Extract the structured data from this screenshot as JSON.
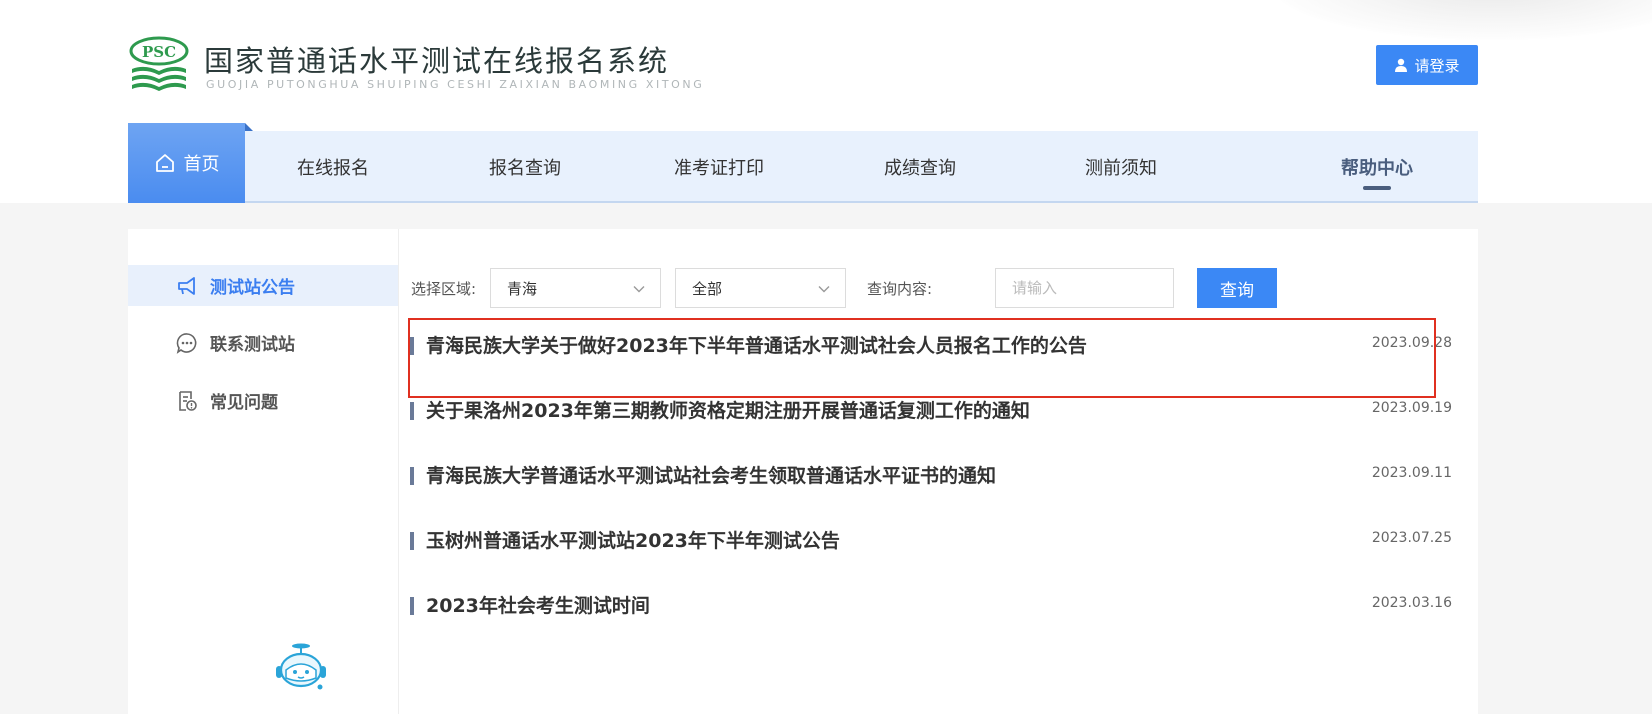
{
  "header": {
    "logo_text": "PSC",
    "title": "国家普通话水平测试在线报名系统",
    "subtitle": "GUOJIA PUTONGHUA SHUIPING CESHI ZAIXIAN BAOMING XITONG",
    "login_label": "请登录"
  },
  "nav": {
    "items": [
      {
        "label": "首页",
        "icon": "home-icon"
      },
      {
        "label": "在线报名"
      },
      {
        "label": "报名查询"
      },
      {
        "label": "准考证打印"
      },
      {
        "label": "成绩查询"
      },
      {
        "label": "测前须知"
      },
      {
        "label": "帮助中心"
      }
    ],
    "active_index": 6
  },
  "sidebar": {
    "items": [
      {
        "label": "测试站公告",
        "icon": "megaphone-icon"
      },
      {
        "label": "联系测试站",
        "icon": "chat-icon"
      },
      {
        "label": "常见问题",
        "icon": "faq-document-icon"
      }
    ],
    "active_index": 0
  },
  "filter": {
    "region_label": "选择区域:",
    "region_value": "青海",
    "category_value": "全部",
    "query_label": "查询内容:",
    "query_placeholder": "请输入",
    "query_button": "查询"
  },
  "news": [
    {
      "title": "青海民族大学关于做好2023年下半年普通话水平测试社会人员报名工作的公告",
      "date": "2023.09.28"
    },
    {
      "title": "关于果洛州2023年第三期教师资格定期注册开展普通话复测工作的通知",
      "date": "2023.09.19"
    },
    {
      "title": "青海民族大学普通话水平测试站社会考生领取普通话水平证书的通知",
      "date": "2023.09.11"
    },
    {
      "title": "玉树州普通话水平测试站2023年下半年测试公告",
      "date": "2023.07.25"
    },
    {
      "title": "2023年社会考生测试时间",
      "date": "2023.03.16"
    }
  ],
  "colors": {
    "accent": "#3b88f5",
    "nav_bg": "#e8f1fd",
    "highlight_border": "#e03020",
    "logo_green": "#2e9a4e"
  }
}
